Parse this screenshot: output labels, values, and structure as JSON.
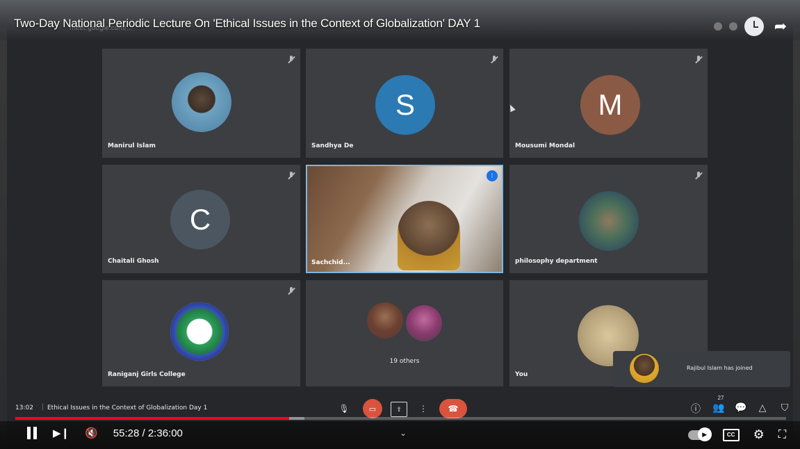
{
  "video": {
    "title": "Two-Day National Periodic Lecture On 'Ethical Issues in the Context of Globalization' DAY 1",
    "current_time": "55:28",
    "duration": "2:36:00",
    "time_display": "55:28 / 2:36:00",
    "progress_fraction": 0.355
  },
  "browser": {
    "url": "meet.google.com/..."
  },
  "meet": {
    "tiles": [
      {
        "name": "Manirul Islam",
        "avatar": "photo"
      },
      {
        "name": "Sandhya De",
        "avatar": "letter",
        "letter": "S",
        "color": "#2b7ab3"
      },
      {
        "name": "Mousumi Mondal",
        "avatar": "letter",
        "letter": "M",
        "color": "#8b5a45"
      },
      {
        "name": "Chaitali Ghosh",
        "avatar": "letter",
        "letter": "C",
        "color": "#4b5660"
      },
      {
        "name": "Sachchid...",
        "avatar": "video"
      },
      {
        "name": "philosophy department",
        "avatar": "photo"
      },
      {
        "name": "Raniganj Girls College",
        "avatar": "logo"
      },
      {
        "name": "19 others",
        "avatar": "group"
      },
      {
        "name": "You",
        "avatar": "photo"
      }
    ],
    "toast": "Rajibul Islam has joined",
    "footer": {
      "time": "13:02",
      "meeting_title": "Ethical Issues in the Context of Globalization Day 1",
      "participants_count": "27"
    }
  },
  "colors": {
    "accent_red": "#ff0033",
    "meet_red": "#d9533f",
    "speaking_blue": "#1a73e8"
  }
}
